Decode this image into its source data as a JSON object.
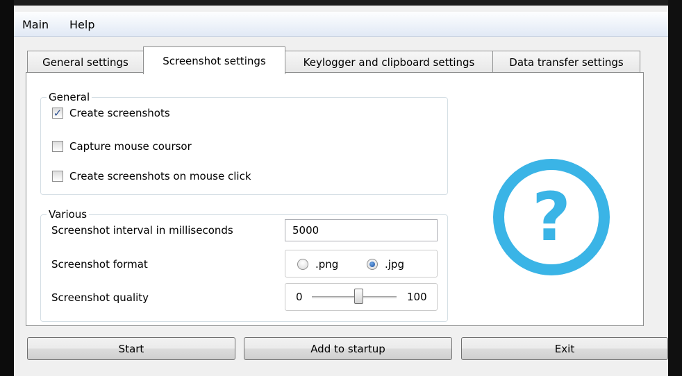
{
  "menu": {
    "items": [
      {
        "label": "Main"
      },
      {
        "label": "Help"
      }
    ]
  },
  "tabs": [
    {
      "label": "General settings",
      "active": false
    },
    {
      "label": "Screenshot settings",
      "active": true
    },
    {
      "label": "Keylogger and clipboard settings",
      "active": false
    },
    {
      "label": "Data transfer settings",
      "active": false
    }
  ],
  "general_group": {
    "title": "General",
    "options": [
      {
        "label": "Create screenshots",
        "checked": true
      },
      {
        "label": "Capture mouse coursor",
        "checked": false
      },
      {
        "label": "Create screenshots on mouse click",
        "checked": false
      }
    ]
  },
  "various_group": {
    "title": "Various",
    "interval_label": "Screenshot interval in milliseconds",
    "interval_value": "5000",
    "format_label": "Screenshot format",
    "format_options": [
      {
        "label": ".png",
        "selected": false
      },
      {
        "label": ".jpg",
        "selected": true
      }
    ],
    "quality_label": "Screenshot quality",
    "quality_min": "0",
    "quality_max": "100",
    "quality_value_fraction": 0.55
  },
  "help": {
    "icon": "question-circle-icon",
    "color": "#3ab4e6"
  },
  "buttons": {
    "start": "Start",
    "add_to_startup": "Add to startup",
    "exit": "Exit"
  }
}
